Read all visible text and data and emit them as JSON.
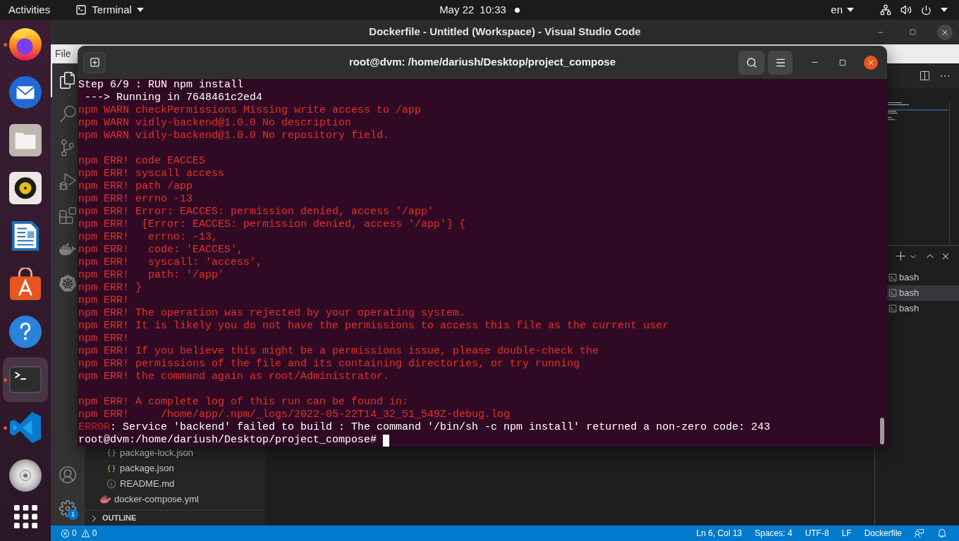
{
  "top_bar": {
    "activities": "Activities",
    "app_menu": "Terminal",
    "date": "May 22",
    "time": "10:33",
    "keyboard_layout": "en"
  },
  "dock": {
    "apps": [
      {
        "kind": "browser",
        "running": true,
        "selected": false
      },
      {
        "kind": "mail",
        "running": false,
        "selected": false
      },
      {
        "kind": "files",
        "running": false,
        "selected": false
      },
      {
        "kind": "music",
        "running": false,
        "selected": false
      },
      {
        "kind": "writer",
        "running": false,
        "selected": false
      },
      {
        "kind": "software",
        "running": false,
        "selected": false
      },
      {
        "kind": "help",
        "running": false,
        "selected": false
      },
      {
        "kind": "terminal",
        "running": true,
        "selected": true
      },
      {
        "kind": "code",
        "running": true,
        "selected": false
      },
      {
        "kind": "disc",
        "running": false,
        "selected": false
      }
    ]
  },
  "vscode": {
    "title": "Dockerfile - Untitled (Workspace) - Visual Studio Code",
    "menu": [
      "File"
    ],
    "activity_bar": [
      {
        "kind": "explorer",
        "selected": true
      },
      {
        "kind": "search",
        "selected": false
      },
      {
        "kind": "source_control",
        "selected": false
      },
      {
        "kind": "run_debug",
        "selected": false
      },
      {
        "kind": "extensions",
        "selected": false
      },
      {
        "kind": "docker",
        "selected": false
      },
      {
        "kind": "kubernetes",
        "selected": false
      }
    ],
    "manage_badge": "1",
    "explorer": {
      "tree": [
        {
          "children": [
            {
              "name": "package-lock.json",
              "kind": "json"
            },
            {
              "name": "package.json",
              "kind": "json"
            },
            {
              "name": "README.md",
              "kind": "info"
            }
          ]
        },
        {
          "name": "docker-compose.yml",
          "kind": "docker"
        }
      ],
      "sections": [
        {
          "label": "OUTLINE",
          "expanded": false
        }
      ]
    },
    "panel": {
      "terminals": [
        {
          "label": "bash",
          "selected": false
        },
        {
          "label": "bash",
          "selected": true
        },
        {
          "label": "bash",
          "selected": false
        }
      ]
    },
    "status_bar": {
      "errors": "0",
      "warnings": "0",
      "items": [
        "Ln 6, Col 13",
        "Spaces: 4",
        "UTF-8",
        "LF",
        "Dockerfile"
      ]
    }
  },
  "terminal": {
    "title": "root@dvm: /home/dariush/Desktop/project_compose",
    "lines": [
      {
        "kind": "output",
        "text": "Step 6/9 : RUN npm install"
      },
      {
        "kind": "output",
        "text": " ---> Running in 7648461c2ed4"
      },
      {
        "kind": "npm",
        "text": "npm WARN checkPermissions Missing write access to /app"
      },
      {
        "kind": "npm",
        "text": "npm WARN vidly-backend@1.0.0 No description"
      },
      {
        "kind": "npm",
        "text": "npm WARN vidly-backend@1.0.0 No repository field."
      },
      {
        "kind": "blank"
      },
      {
        "kind": "npm",
        "text": "npm ERR! code EACCES"
      },
      {
        "kind": "npm",
        "text": "npm ERR! syscall access"
      },
      {
        "kind": "npm",
        "text": "npm ERR! path /app"
      },
      {
        "kind": "npm",
        "text": "npm ERR! errno -13"
      },
      {
        "kind": "npm",
        "text": "npm ERR! Error: EACCES: permission denied, access '/app'"
      },
      {
        "kind": "npm",
        "text": "npm ERR!  [Error: EACCES: permission denied, access '/app'] {"
      },
      {
        "kind": "npm",
        "text": "npm ERR!   errno: -13,"
      },
      {
        "kind": "npm",
        "text": "npm ERR!   code: 'EACCES',"
      },
      {
        "kind": "npm",
        "text": "npm ERR!   syscall: 'access',"
      },
      {
        "kind": "npm",
        "text": "npm ERR!   path: '/app'"
      },
      {
        "kind": "npm",
        "text": "npm ERR! }"
      },
      {
        "kind": "npm",
        "text": "npm ERR!"
      },
      {
        "kind": "npm",
        "text": "npm ERR! The operation was rejected by your operating system."
      },
      {
        "kind": "npm",
        "text": "npm ERR! It is likely you do not have the permissions to access this file as the current user"
      },
      {
        "kind": "npm",
        "text": "npm ERR!"
      },
      {
        "kind": "npm",
        "text": "npm ERR! If you believe this might be a permissions issue, please double-check the"
      },
      {
        "kind": "npm",
        "text": "npm ERR! permissions of the file and its containing directories, or try running"
      },
      {
        "kind": "npm",
        "text": "npm ERR! the command again as root/Administrator."
      },
      {
        "kind": "blank"
      },
      {
        "kind": "npm",
        "text": "npm ERR! A complete log of this run can be found in:"
      },
      {
        "kind": "npm",
        "text": "npm ERR!     /home/app/.npm/_logs/2022-05-22T14_32_51_549Z-debug.log"
      },
      {
        "kind": "error",
        "prefix": "ERROR",
        "text": ": Service 'backend' failed to build : The command '/bin/sh -c npm install' returned a non-zero code: 243"
      },
      {
        "kind": "prompt",
        "text": "root@dvm:/home/dariush/Desktop/project_compose#",
        "cursor": true
      }
    ]
  }
}
